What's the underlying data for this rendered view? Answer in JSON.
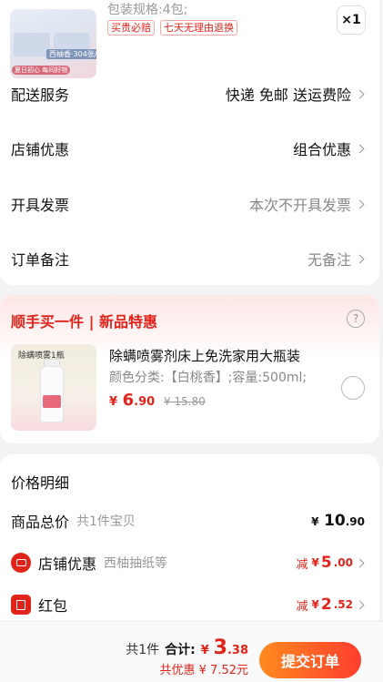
{
  "product": {
    "spec": "包装规格:4包;",
    "tags": [
      "买贵必赔",
      "七天无理由退换"
    ],
    "quantity": "×1",
    "thumb_label": "西柚香·304张/包",
    "thumb_sub": "夏日初心  每间好物"
  },
  "order_rows": [
    {
      "label": "配送服务",
      "value": "快递 免邮 送运费险"
    },
    {
      "label": "店铺优惠",
      "value": "组合优惠"
    },
    {
      "label": "开具发票",
      "value": "本次不开具发票"
    },
    {
      "label": "订单备注",
      "value": "无备注"
    }
  ],
  "promo": {
    "title": "顺手买一件 | 新品特惠",
    "help_icon": "?",
    "item": {
      "thumb_caption": "除螨喷雾1瓶",
      "name": "除螨喷雾剂床上免洗家用大瓶装",
      "desc": "颜色分类:【白桃香】;容量:500ml;",
      "currency": "¥",
      "price_int": "6",
      "price_dec": ".90",
      "old_price": "¥ 15.80"
    }
  },
  "price_detail": {
    "title": "价格明细",
    "total": {
      "label": "商品总价",
      "sub": "共1件宝贝",
      "currency": "¥",
      "int": "10",
      "dec": ".90"
    },
    "shop_discount": {
      "label": "店铺优惠",
      "sub": "西柚抽纸等",
      "lead": "减",
      "currency": "¥",
      "int": "5",
      "dec": ".00"
    },
    "red_packet": {
      "label": "红包",
      "lead": "减",
      "currency": "¥",
      "int": "2",
      "dec": ".52"
    }
  },
  "bottom_bar": {
    "count": "共1件",
    "sum_label": "合计:",
    "currency": "¥",
    "int": "3",
    "dec": ".38",
    "saving": "共优惠 ¥ 7.52元",
    "submit": "提交订单"
  },
  "colors": {
    "accent": "#e2231a",
    "button_start": "#ff8a1f",
    "button_end": "#ff3d2e"
  }
}
